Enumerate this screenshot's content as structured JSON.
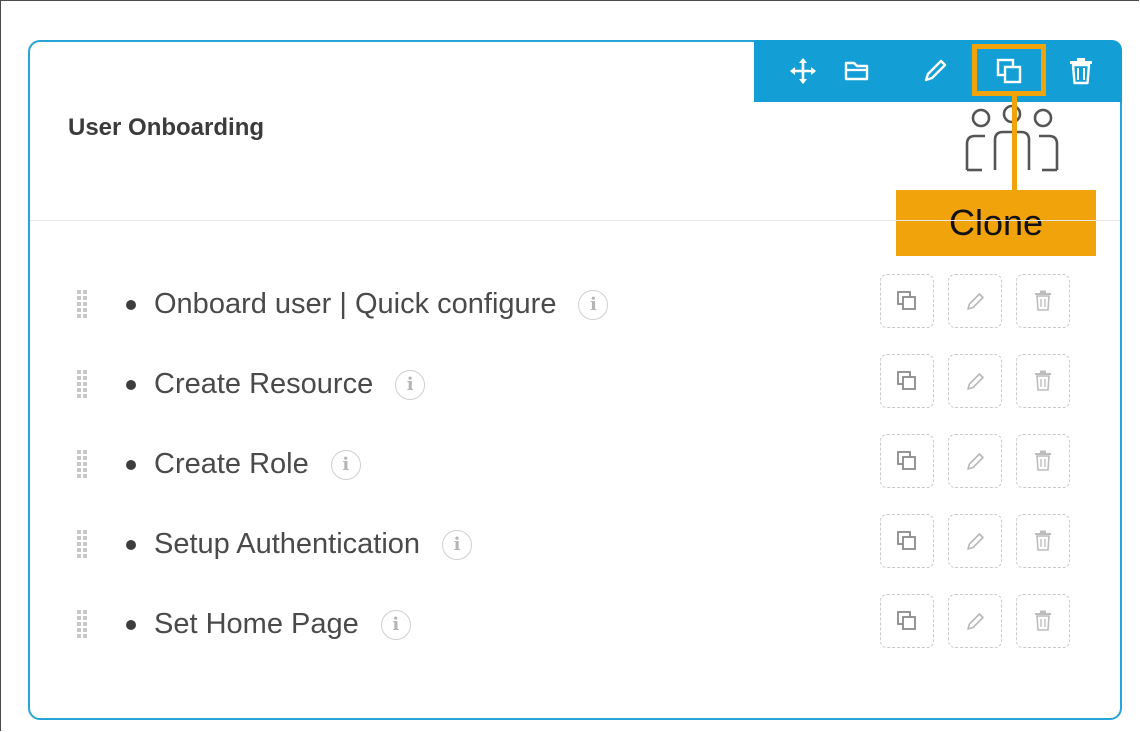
{
  "card": {
    "title": "User Onboarding",
    "icon": "users-group-icon"
  },
  "toolbar": {
    "color": "#139fd6",
    "buttons": [
      {
        "name": "move",
        "icon": "move-arrows-icon"
      },
      {
        "name": "folder",
        "icon": "folder-icon"
      },
      {
        "name": "edit",
        "icon": "pencil-icon"
      },
      {
        "name": "clone",
        "icon": "clone-icon"
      },
      {
        "name": "delete",
        "icon": "trash-icon"
      }
    ]
  },
  "callout": {
    "label": "Clone",
    "color": "#f0a30a"
  },
  "tasks": [
    {
      "label": "Onboard user | Quick configure"
    },
    {
      "label": "Create Resource"
    },
    {
      "label": "Create Role"
    },
    {
      "label": "Setup Authentication"
    },
    {
      "label": "Set Home Page"
    }
  ],
  "row_actions": [
    "clone-icon",
    "pencil-icon",
    "trash-icon"
  ],
  "info_glyph": "i"
}
